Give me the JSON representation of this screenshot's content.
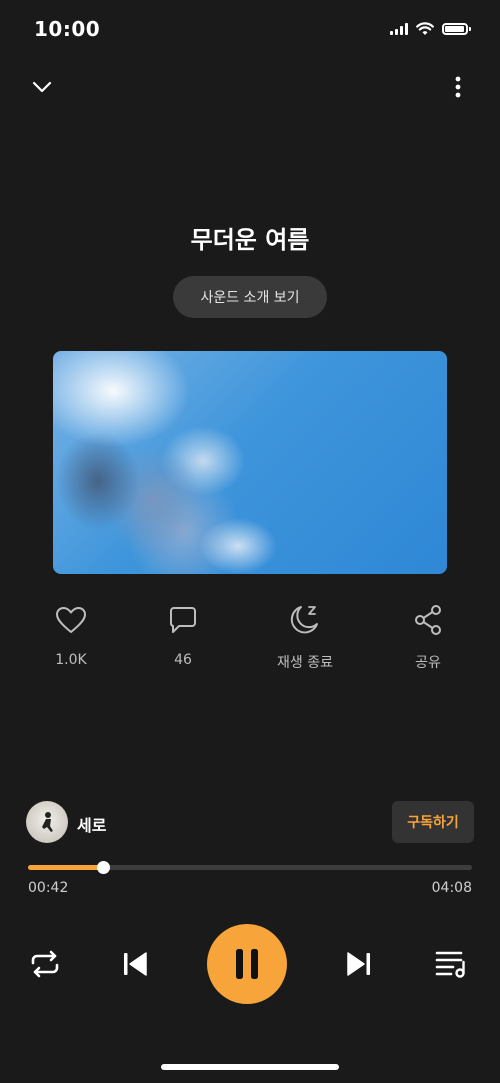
{
  "status_bar": {
    "time": "10:00"
  },
  "header": {
    "collapse_icon": "chevron-down-icon",
    "menu_icon": "more-vertical-icon"
  },
  "track": {
    "title": "무더운 여름",
    "intro_button": "사운드 소개 보기",
    "cover_image": "sky-clouds-sunlight"
  },
  "actions": [
    {
      "icon": "heart-icon",
      "label": "1.0K"
    },
    {
      "icon": "comment-icon",
      "label": "46"
    },
    {
      "icon": "sleep-timer-icon",
      "label": "재생 종료"
    },
    {
      "icon": "share-icon",
      "label": "공유"
    }
  ],
  "artist": {
    "name": "세로",
    "subscribe_label": "구독하기"
  },
  "progress": {
    "current": "00:42",
    "total": "04:08",
    "fraction": 0.17
  },
  "controls": {
    "repeat_icon": "repeat-icon",
    "prev_icon": "skip-previous-icon",
    "play_state_icon": "pause-icon",
    "next_icon": "skip-next-icon",
    "playlist_icon": "playlist-icon"
  },
  "colors": {
    "accent": "#f7a43a",
    "background": "#1a1a1a",
    "button_bg": "#3a3a3a"
  }
}
